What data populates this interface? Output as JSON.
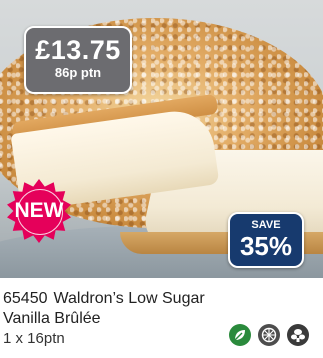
{
  "product": {
    "code": "65450",
    "name_line1": "Waldron’s Low Sugar",
    "name_line2": "Vanilla Brûlée",
    "pack_size": "1 x 16ptn"
  },
  "price": {
    "amount": "£13.75",
    "per_unit": "86p ptn"
  },
  "badges": {
    "new_label": "NEW",
    "save_label": "SAVE",
    "save_value": "35%"
  },
  "colors": {
    "new_badge": "#e5005a",
    "save_badge": "#173a6e",
    "price_badge": "#6c6c70",
    "vegetarian_icon": "#2a8a3c"
  },
  "icons": [
    "vegetarian-leaf-icon",
    "dietary-icon",
    "allergen-icon"
  ]
}
